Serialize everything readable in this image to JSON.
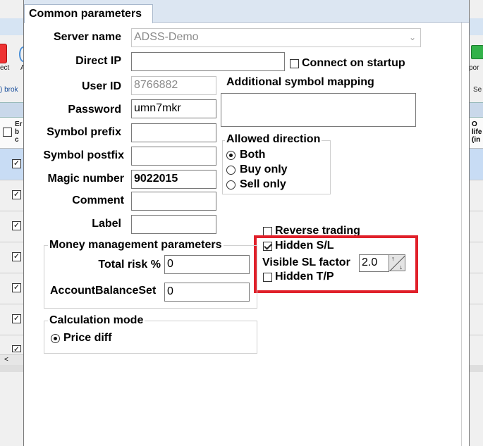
{
  "background": {
    "left": {
      "snippet_ect": "ect",
      "snippet_a": "A",
      "snippet_brok": ") brok",
      "grid_header_text": "Er\nb\nc",
      "scroll_arrow": "<"
    },
    "right": {
      "snippet_por": "por",
      "snippet_se": "Se",
      "grid_header_text": "O\nlife\n(in"
    }
  },
  "tab": {
    "label": "Common parameters"
  },
  "form": {
    "server_name": {
      "label": "Server name",
      "value": "ADSS-Demo"
    },
    "direct_ip": {
      "label": "Direct IP",
      "value": ""
    },
    "connect_on_startup": {
      "label": "Connect on startup",
      "checked": false
    },
    "user_id": {
      "label": "User ID",
      "value": "8766882"
    },
    "password": {
      "label": "Password",
      "value": "umn7mkr"
    },
    "symbol_prefix": {
      "label": "Symbol prefix",
      "value": ""
    },
    "symbol_postfix": {
      "label": "Symbol postfix",
      "value": ""
    },
    "magic_number": {
      "label": "Magic number",
      "value": "9022015"
    },
    "comment": {
      "label": "Comment",
      "value": ""
    },
    "label": {
      "label": "Label",
      "value": ""
    },
    "additional_symbol_mapping": {
      "label": "Additional symbol mapping",
      "value": ""
    }
  },
  "allowed_direction": {
    "title": "Allowed direction",
    "options": [
      {
        "label": "Both",
        "selected": true
      },
      {
        "label": "Buy only",
        "selected": false
      },
      {
        "label": "Sell only",
        "selected": false
      }
    ]
  },
  "trading_options": {
    "reverse_trading": {
      "label": "Reverse trading",
      "checked": false
    },
    "hidden_sl": {
      "label": "Hidden S/L",
      "checked": true
    },
    "visible_sl_factor": {
      "label": "Visible SL factor",
      "value": "2.0"
    },
    "hidden_tp": {
      "label": "Hidden T/P",
      "checked": false
    }
  },
  "money_management": {
    "title": "Money management parameters",
    "total_risk": {
      "label": "Total risk %",
      "value": "0"
    },
    "account_balance_set": {
      "label": "AccountBalanceSet",
      "value": "0"
    }
  },
  "calculation_mode": {
    "title": "Calculation mode",
    "options": [
      {
        "label": "Price diff",
        "selected": true
      }
    ]
  },
  "colors": {
    "highlight_border": "#e0202a",
    "tab_bar": "#dce6f2",
    "selected_row": "#c8dcf4"
  }
}
